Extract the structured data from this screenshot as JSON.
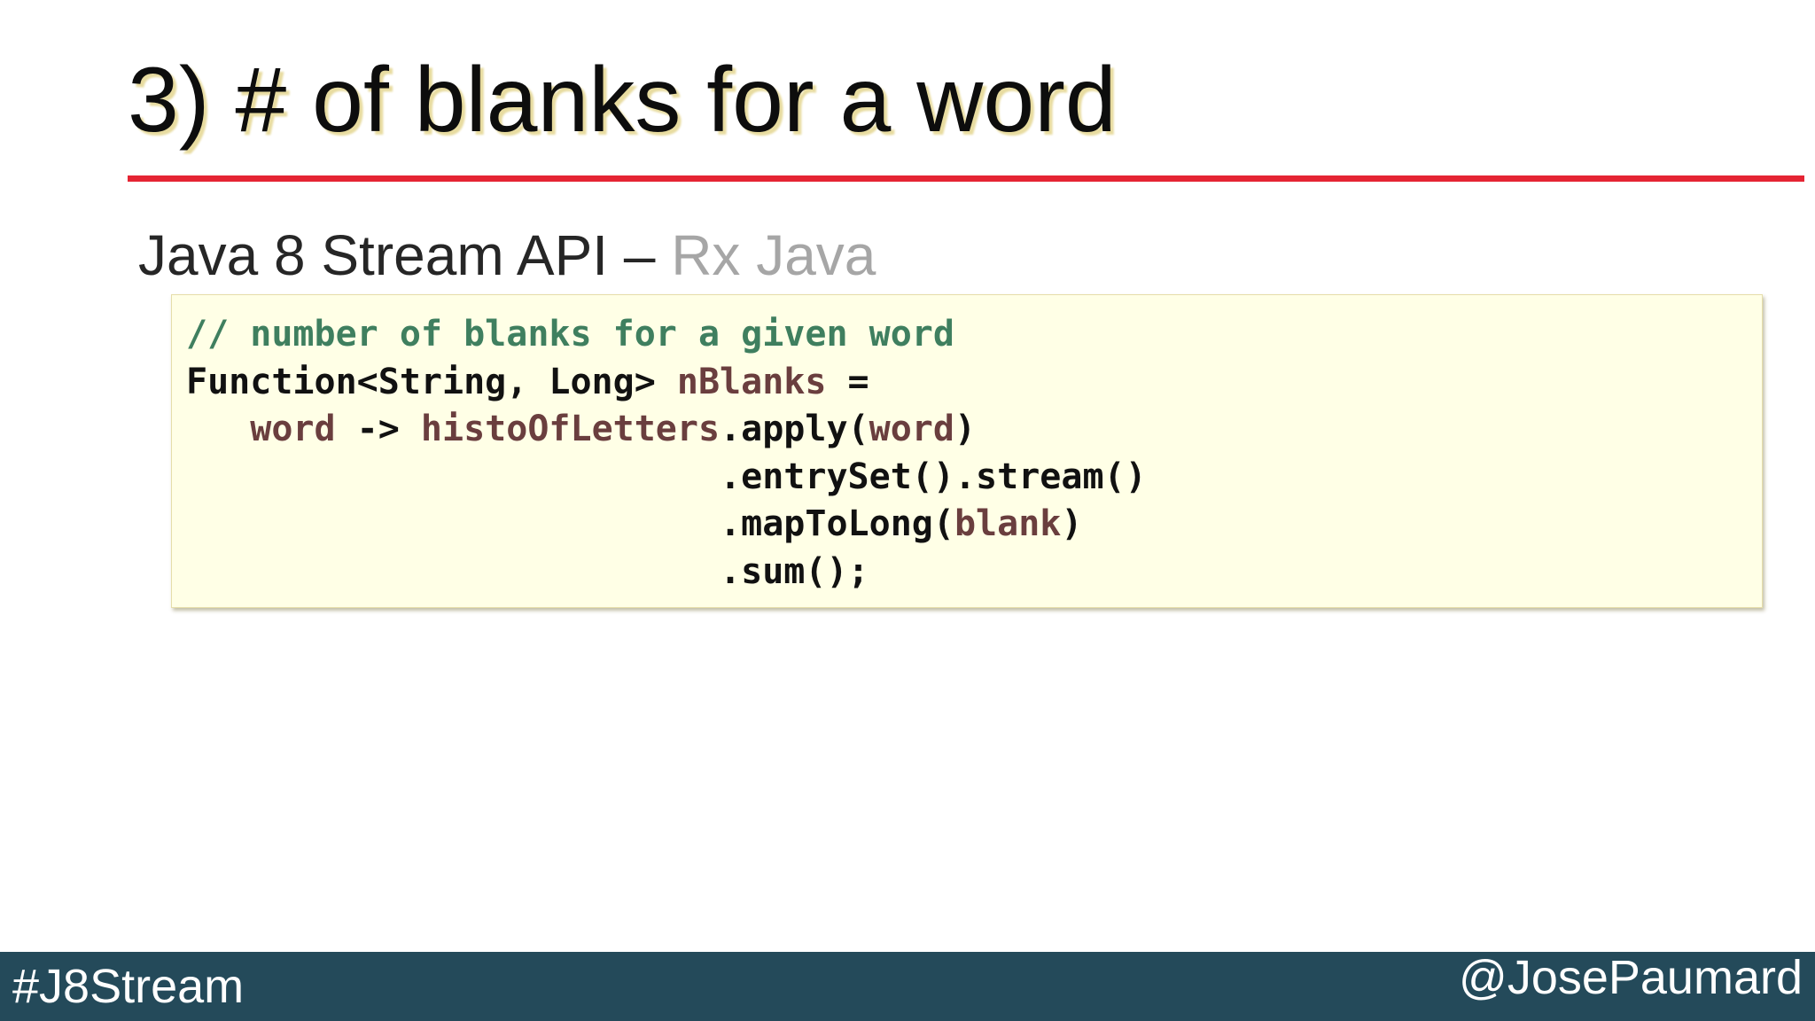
{
  "title": "3) # of blanks for a word",
  "subtitle": {
    "primary": "Java 8 Stream API – ",
    "secondary": "Rx Java"
  },
  "code": {
    "lines": [
      [
        {
          "text": "// number of blanks for a given word",
          "kind": "comment"
        }
      ],
      [
        {
          "text": "Function<String, Long> ",
          "kind": "plain"
        },
        {
          "text": "nBlanks",
          "kind": "ident"
        },
        {
          "text": " =",
          "kind": "plain"
        }
      ],
      [
        {
          "text": "   ",
          "kind": "plain"
        },
        {
          "text": "word",
          "kind": "ident"
        },
        {
          "text": " -> ",
          "kind": "plain"
        },
        {
          "text": "histoOfLetters",
          "kind": "ident"
        },
        {
          "text": ".apply(",
          "kind": "plain"
        },
        {
          "text": "word",
          "kind": "ident"
        },
        {
          "text": ")",
          "kind": "plain"
        }
      ],
      [
        {
          "text": "                         .entrySet().stream()",
          "kind": "plain"
        }
      ],
      [
        {
          "text": "                         .mapToLong(",
          "kind": "plain"
        },
        {
          "text": "blank",
          "kind": "ident"
        },
        {
          "text": ")",
          "kind": "plain"
        }
      ],
      [
        {
          "text": "                         .sum();",
          "kind": "plain"
        }
      ]
    ]
  },
  "footer": {
    "hashtag": "#J8Stream",
    "handle": "@JosePaumard"
  },
  "colors": {
    "title_rule": "#e52433",
    "code_background": "#ffffe6",
    "comment": "#3f7f5f",
    "identifier": "#6a3e3e",
    "footer_background": "#244a5a",
    "muted_text": "#a6a6a6"
  }
}
